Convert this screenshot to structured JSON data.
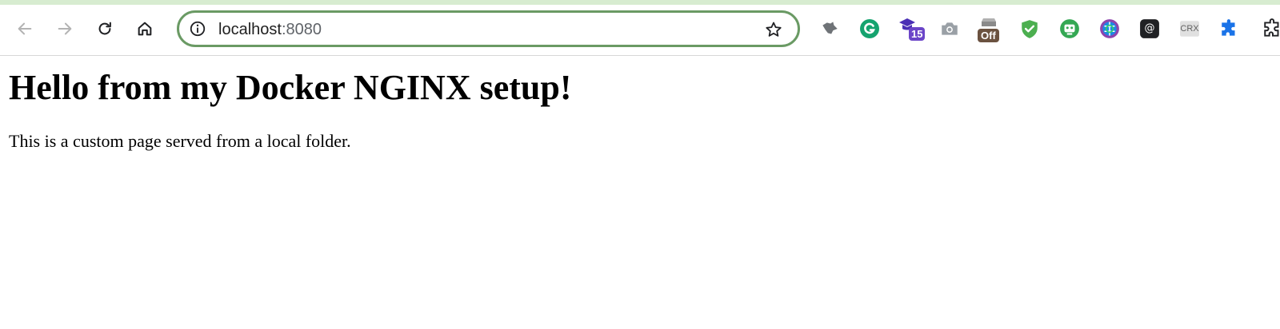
{
  "browser": {
    "address_bar": {
      "host": "localhost",
      "port": ":8080"
    },
    "nav_icons": [
      "back-arrow-icon",
      "forward-arrow-icon",
      "reload-icon",
      "home-icon"
    ],
    "omnibox_icons": [
      "site-info-icon",
      "bookmark-star-icon"
    ],
    "extensions": [
      {
        "name": "wolf-extension-icon",
        "color": "#6f7377"
      },
      {
        "name": "grammarly-icon",
        "color": "#15a36f"
      },
      {
        "name": "graduation-cap-extension-icon",
        "color": "#4a2fb5",
        "badge": "15"
      },
      {
        "name": "camera-extension-icon",
        "color": "#9aa0a6"
      },
      {
        "name": "toggle-extension-icon",
        "color": "#6b5240",
        "badge": "Off"
      },
      {
        "name": "shield-check-extension-icon",
        "color": "#4caf50"
      },
      {
        "name": "robot-extension-icon",
        "color": "#34a853"
      },
      {
        "name": "globe-extension-icon",
        "color": "#1e88e5"
      },
      {
        "name": "at-sign-extension-icon",
        "color": "#202124",
        "label": "@"
      },
      {
        "name": "crx-extension-icon",
        "color": "#9e9e9e",
        "label": "CRX"
      },
      {
        "name": "extensions-puzzle-icon",
        "color": "#1a73e8"
      },
      {
        "name": "side-panel-icon",
        "color": "#202124"
      }
    ]
  },
  "page": {
    "heading": "Hello from my Docker NGINX setup!",
    "paragraph": "This is a custom page served from a local folder."
  }
}
